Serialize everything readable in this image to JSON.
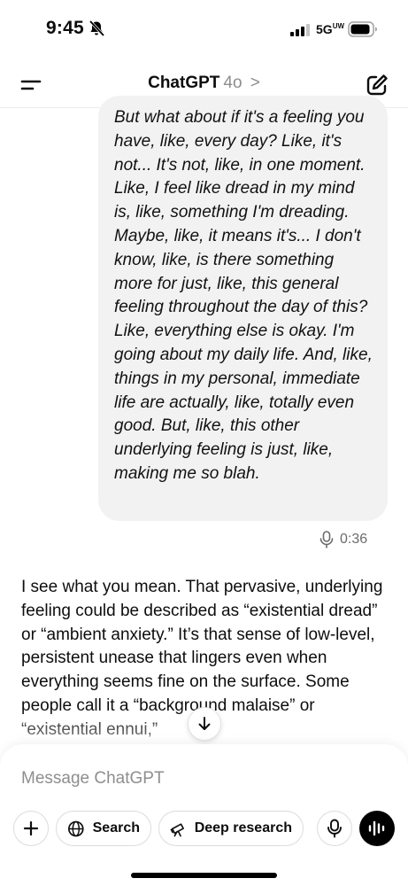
{
  "status_bar": {
    "time": "9:45",
    "network": "5G",
    "network_sup": "UW"
  },
  "header": {
    "title": "ChatGPT",
    "model": "4o",
    "chevron": ">"
  },
  "conversation": {
    "user_message": "But what about if it's a feeling you have, like, every day? Like, it's not... It's not, like, in one moment. Like, I feel like dread in my mind is, like, something I'm dreading. Maybe, like, it means it's... I don't know, like, is there something more for just, like, this general feeling throughout the day of this? Like, everything else is okay. I'm going about my daily life. And, like, things in my personal, immediate life are actually, like, totally even good. But, like, this other underlying feeling is just, like, making me so blah.",
    "voice_duration": "0:36",
    "assistant_message": "I see what you mean. That pervasive, underlying feeling could be described as “existential dread” or “ambient anxiety.” It’s that sense of low-level, persistent unease that lingers even when everything seems fine on the surface. Some people call it a “background malaise” or “existential ennui,”"
  },
  "composer": {
    "placeholder": "Message ChatGPT",
    "search_label": "Search",
    "deep_research_label": "Deep research"
  },
  "icons": {
    "menu": "menu-icon",
    "compose": "new-chat-icon",
    "mic": "mic-icon",
    "voice": "voice-mode-icon",
    "search": "globe-icon",
    "deep_research": "telescope-icon",
    "plus": "plus-icon",
    "scroll": "arrow-down-icon"
  }
}
